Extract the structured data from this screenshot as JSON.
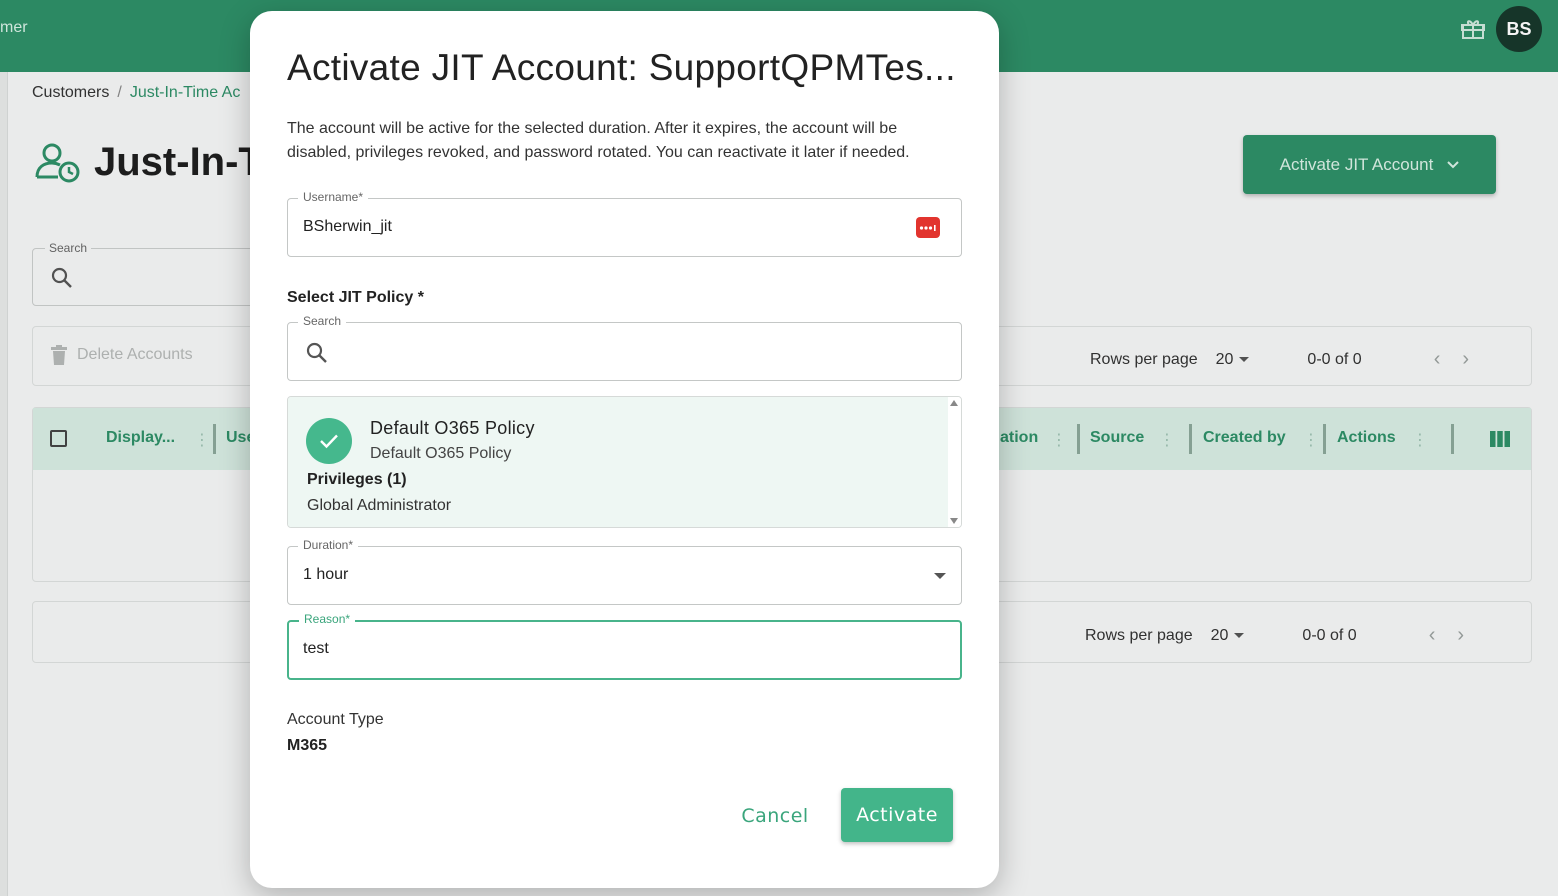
{
  "app": {
    "title_fragment": "mer",
    "avatar_initials": "BS",
    "breadcrumb": {
      "root": "Customers",
      "separator": "/",
      "current": "Just-In-Time Ac"
    },
    "page_title": "Just-In-T",
    "search_label": "Search",
    "activate_button_label": "Activate JIT Account",
    "toolbar": {
      "delete_label": "Delete Accounts"
    },
    "pagination": {
      "rows_per_page_label": "Rows per page",
      "rows_per_page_value": "20",
      "range": "0-0 of 0"
    },
    "table": {
      "columns": [
        {
          "label": "Display..."
        },
        {
          "label": "Use"
        },
        {
          "label": "ation"
        },
        {
          "label": "Source"
        },
        {
          "label": "Created by"
        },
        {
          "label": "Actions"
        }
      ]
    }
  },
  "modal": {
    "title": "Activate JIT Account: SupportQPMTes...",
    "description": "The account will be active for the selected duration. After it expires, the account will be disabled, privileges revoked, and password rotated. You can reactivate it later if needed.",
    "username": {
      "label": "Username*",
      "value": "BSherwin_jit"
    },
    "policy_section_label": "Select JIT Policy *",
    "policy_search": {
      "label": "Search",
      "value": ""
    },
    "selected_policy": {
      "name": "Default O365 Policy",
      "subtitle": "Default O365 Policy",
      "privileges_label": "Privileges (1)",
      "privilege": "Global Administrator"
    },
    "duration": {
      "label": "Duration*",
      "value": "1 hour"
    },
    "reason": {
      "label": "Reason*",
      "value": "test"
    },
    "account_type": {
      "label": "Account Type",
      "value": "M365"
    },
    "cancel_label": "Cancel",
    "activate_label": "Activate"
  },
  "colors": {
    "brand_green": "#2e8f68",
    "accent_green": "#43b58a",
    "password_icon_red": "#e2342e"
  },
  "icons": {
    "gift": "gift-icon",
    "search": "search-icon",
    "trash": "trash-icon",
    "check": "check-icon",
    "password": "password-dots-icon",
    "columns": "columns-icon",
    "user_clock": "user-clock-icon"
  }
}
